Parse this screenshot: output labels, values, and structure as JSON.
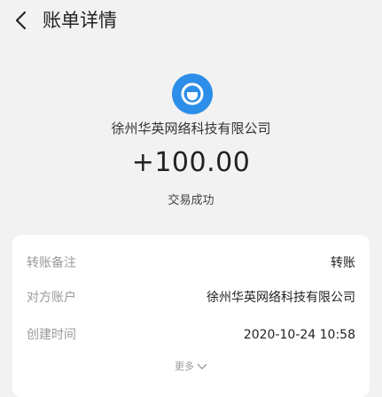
{
  "header": {
    "title": "账单详情",
    "back_icon": "chevron-left-icon"
  },
  "summary": {
    "avatar_icon": "person-icon",
    "avatar_color": "#2c8ee8",
    "merchant": "徐州华英网络科技有限公司",
    "amount": "+100.00",
    "status": "交易成功"
  },
  "details": {
    "rows": [
      {
        "label": "转账备注",
        "value": "转账"
      },
      {
        "label": "对方账户",
        "value": "徐州华英网络科技有限公司"
      },
      {
        "label": "创建时间",
        "value": "2020-10-24 10:58"
      }
    ],
    "more_label": "更多",
    "more_icon": "chevron-down-icon"
  }
}
